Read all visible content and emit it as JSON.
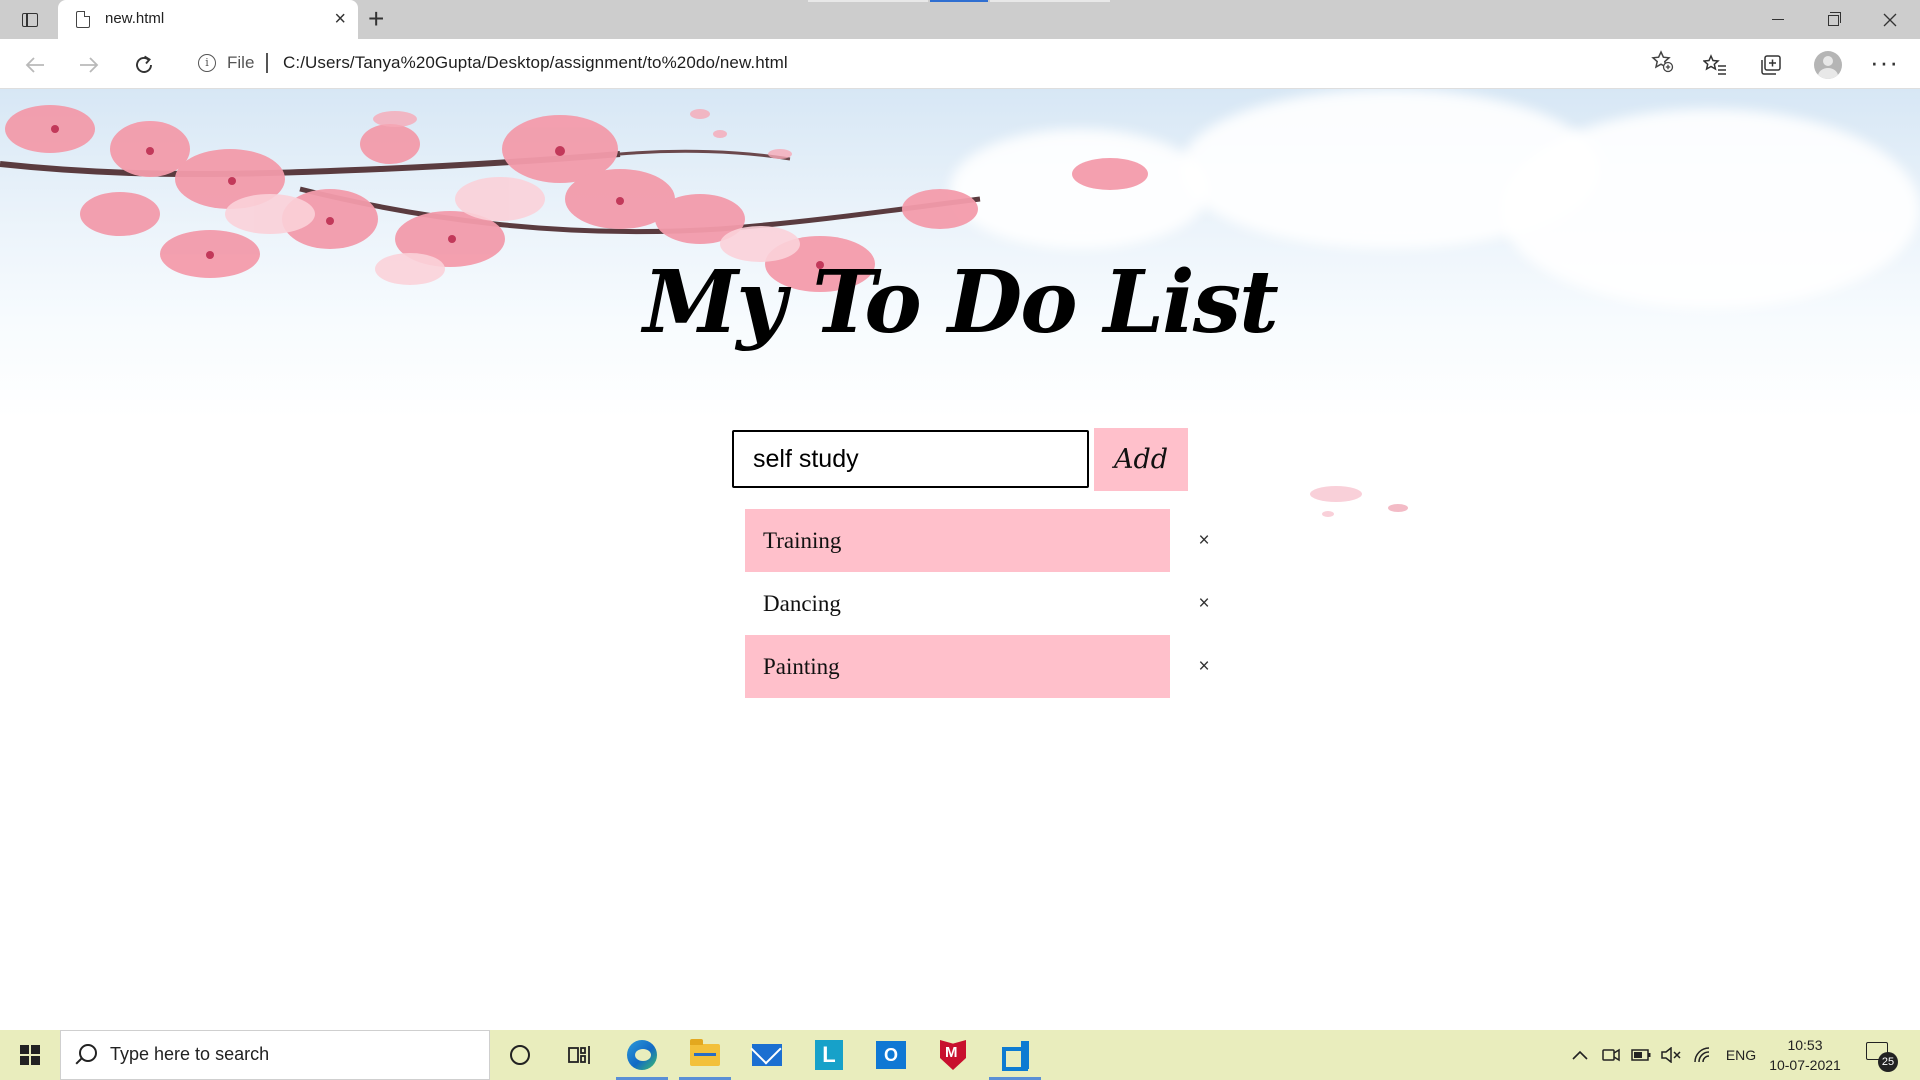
{
  "browser": {
    "tab": {
      "title": "new.html",
      "close": "×"
    },
    "new_tab": "+",
    "address": {
      "scheme_label": "File",
      "url": "C:/Users/Tanya%20Gupta/Desktop/assignment/to%20do/new.html"
    },
    "more": "···"
  },
  "page": {
    "title": "My To Do List",
    "input": {
      "value": "self study"
    },
    "add_label": "Add",
    "items": [
      {
        "text": "Training",
        "checked": true,
        "close": "×"
      },
      {
        "text": "Dancing",
        "checked": false,
        "close": "×"
      },
      {
        "text": "Painting",
        "checked": true,
        "close": "×"
      }
    ],
    "colors": {
      "accent": "#ffc0cb"
    }
  },
  "taskbar": {
    "search_placeholder": "Type here to search",
    "apps": [
      "task-view",
      "edge",
      "file-explorer",
      "mail",
      "l-app",
      "outlook",
      "mcafee",
      "vscode"
    ],
    "tray_lang": "ENG",
    "time": "10:53",
    "date": "10-07-2021",
    "notification_count": "25"
  }
}
